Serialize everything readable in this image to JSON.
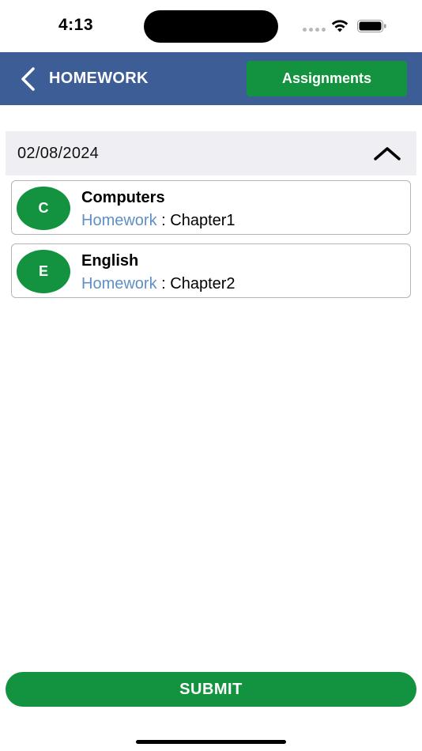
{
  "status_bar": {
    "time": "4:13",
    "icons": [
      "signal-dots-icon",
      "wifi-icon",
      "battery-icon"
    ]
  },
  "header": {
    "title": "HOMEWORK",
    "back_icon": "chevron-left-icon",
    "assignments_label": "Assignments",
    "background_color": "#3d5d97"
  },
  "date_section": {
    "date": "02/08/2024",
    "expanded": true,
    "toggle_icon": "chevron-up-icon"
  },
  "homework_items": [
    {
      "initial": "C",
      "subject": "Computers",
      "label": "Homework",
      "separator": " : ",
      "value": "Chapter1"
    },
    {
      "initial": "E",
      "subject": "English",
      "label": "Homework",
      "separator": " : ",
      "value": "Chapter2"
    }
  ],
  "submit_label": "SUBMIT",
  "colors": {
    "primary_green": "#13923f",
    "header_blue": "#3d5d97",
    "link_blue": "#5e8fc5",
    "date_bg": "#efeff3"
  }
}
